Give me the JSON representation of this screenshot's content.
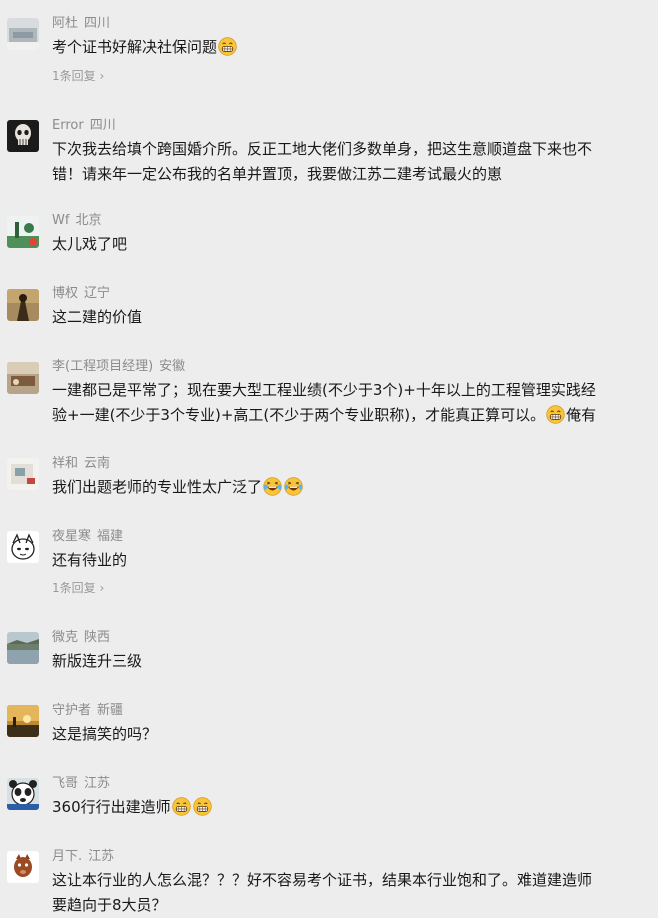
{
  "comments": [
    {
      "name": "阿杜",
      "region": "四川",
      "line1": "考个证书好解决社保问题",
      "emoji": "grin-face-icon",
      "replies": "1条回复"
    },
    {
      "name": "Error",
      "region": "四川",
      "line1": "下次我去给填个跨国婚介所。反正工地大佬们多数单身，把这生意顺道盘下来也不",
      "line2": "错！请来年一定公布我的名单并置顶，我要做江苏二建考试最火的崽"
    },
    {
      "name": "Wf",
      "region": "北京",
      "line1": "太儿戏了吧"
    },
    {
      "name": "博权",
      "region": "辽宁",
      "line1": "这二建的价值"
    },
    {
      "name": "李(工程项目经理)",
      "region": "安徽",
      "line1": "一建都已是平常了；现在要大型工程业绩(不少于3个)+十年以上的工程管理实践经",
      "line2": "验+一建(不少于3个专业)+高工(不少于两个专业职称)，才能真正算可以。",
      "line2_tail": "俺有"
    },
    {
      "name": "祥和",
      "region": "云南",
      "line1": "我们出题老师的专业性太广泛了"
    },
    {
      "name": "夜星寒",
      "region": "福建",
      "line1": "还有待业的",
      "replies": "1条回复"
    },
    {
      "name": "微克",
      "region": "陕西",
      "line1": "新版连升三级"
    },
    {
      "name": "守护者",
      "region": "新疆",
      "line1": "这是搞笑的吗？"
    },
    {
      "name": "飞哥",
      "region": "江苏",
      "line1": "360行行出建造师"
    },
    {
      "name": "月下.",
      "region": "江苏",
      "line1": "这让本行业的人怎么混？？？好不容易考个证书，结果本行业饱和了。难道建造师",
      "line2": "要趋向于8大员？"
    }
  ],
  "colors": {
    "background": "#ededed",
    "name": "#8c8c8c",
    "text": "#191919",
    "reply_link": "#9a9a9a"
  }
}
